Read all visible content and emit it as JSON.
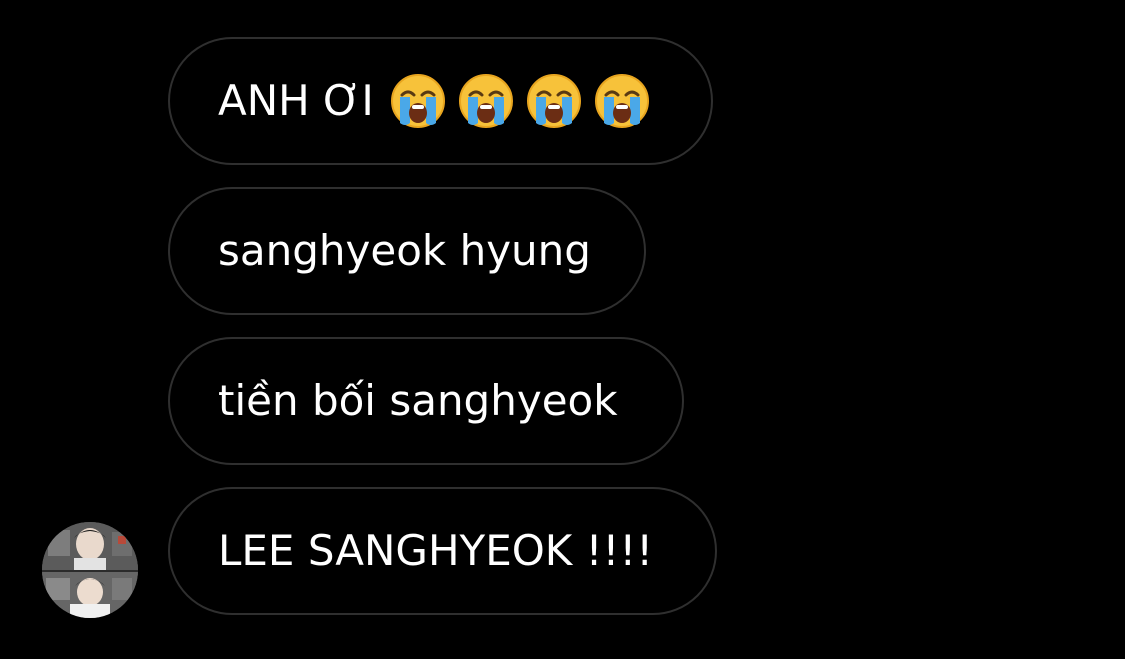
{
  "messages": [
    {
      "text": "ANH ƠI",
      "emoji_icon": "loudly-crying-face-icon",
      "emoji_count": 4
    },
    {
      "text": "sanghyeok hyung"
    },
    {
      "text": "tiền bối sanghyeok"
    },
    {
      "text": "LEE SANGHYEOK !!!!"
    }
  ],
  "sender": {
    "avatar_icon": "user-photo-avatar"
  },
  "colors": {
    "background": "#000000",
    "bubble_border": "#2f2f2f",
    "text": "#ffffff",
    "emoji_face": "#f7c23a",
    "emoji_tears": "#4aa8e8"
  }
}
